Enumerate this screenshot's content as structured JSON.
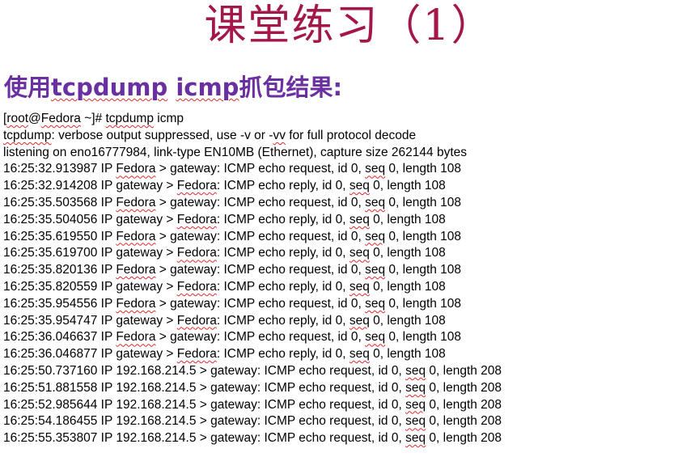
{
  "slide": {
    "title": "课堂练习（1）",
    "subtitle_prefix": "使用",
    "subtitle_cmd1": "tcpdump",
    "subtitle_space": " ",
    "subtitle_cmd2": "icmp",
    "subtitle_suffix": "抓包结果:"
  },
  "console": {
    "lines": [
      "[root@Fedora ~]# tcpdump icmp",
      "tcpdump: verbose output suppressed, use -v or -vv for full protocol decode",
      "listening on eno16777984, link-type EN10MB (Ethernet), capture size 262144 bytes",
      "16:25:32.913987 IP Fedora > gateway: ICMP echo request, id 0, seq 0, length 108",
      "16:25:32.914208 IP gateway > Fedora: ICMP echo reply, id 0, seq 0, length 108",
      "16:25:35.503568 IP Fedora > gateway: ICMP echo request, id 0, seq 0, length 108",
      "16:25:35.504056 IP gateway > Fedora: ICMP echo reply, id 0, seq 0, length 108",
      "16:25:35.619550 IP Fedora > gateway: ICMP echo request, id 0, seq 0, length 108",
      "16:25:35.619700 IP gateway > Fedora: ICMP echo reply, id 0, seq 0, length 108",
      "16:25:35.820136 IP Fedora > gateway: ICMP echo request, id 0, seq 0, length 108",
      "16:25:35.820559 IP gateway > Fedora: ICMP echo reply, id 0, seq 0, length 108",
      "16:25:35.954556 IP Fedora > gateway: ICMP echo request, id 0, seq 0, length 108",
      "16:25:35.954747 IP gateway > Fedora: ICMP echo reply, id 0, seq 0, length 108",
      "16:25:36.046637 IP Fedora > gateway: ICMP echo request, id 0, seq 0, length 108",
      "16:25:36.046877 IP gateway > Fedora: ICMP echo reply, id 0, seq 0, length 108",
      "16:25:50.737160 IP 192.168.214.5 > gateway: ICMP echo request, id 0, seq 0, length 208",
      "16:25:51.881558 IP 192.168.214.5 > gateway: ICMP echo request, id 0, seq 0, length 208",
      "16:25:52.985644 IP 192.168.214.5 > gateway: ICMP echo request, id 0, seq 0, length 208",
      "16:25:54.186455 IP 192.168.214.5 > gateway: ICMP echo request, id 0, seq 0, length 208",
      "16:25:55.353807 IP 192.168.214.5 > gateway: ICMP echo request, id 0, seq 0, length 208"
    ]
  },
  "spellcheck_words": [
    "tcpdump",
    "root",
    "Fedora",
    "vv",
    "seq"
  ]
}
